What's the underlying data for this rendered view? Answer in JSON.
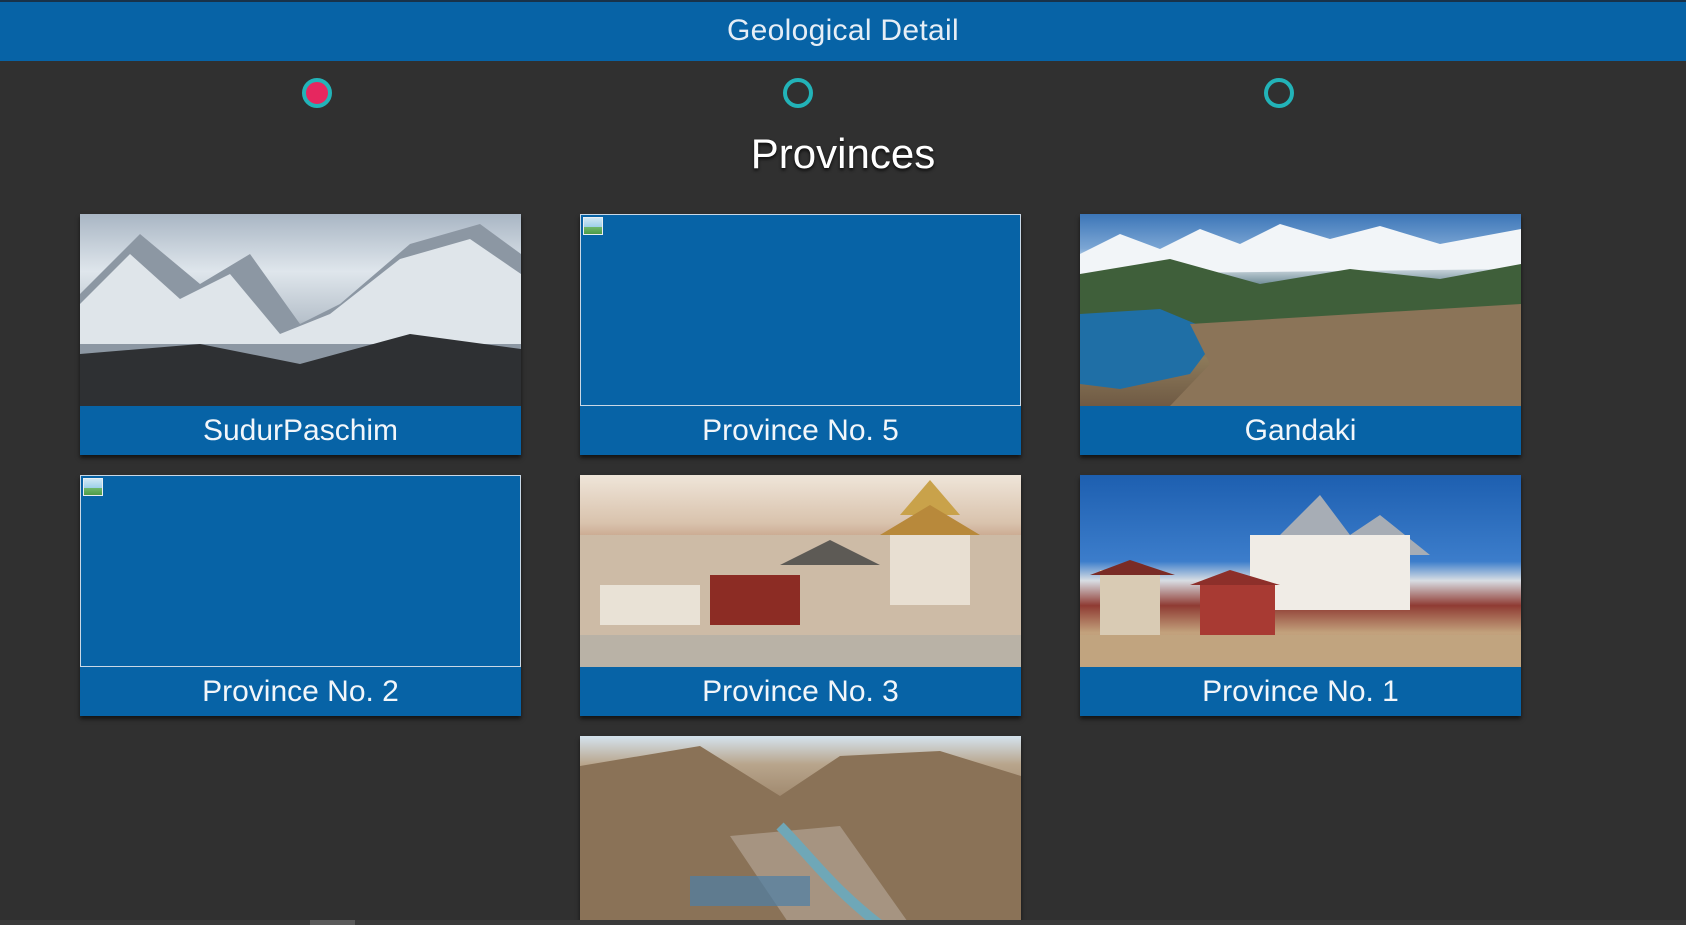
{
  "header": {
    "title": "Geological Detail"
  },
  "steps": [
    {
      "state": "active"
    },
    {
      "state": "inactive"
    },
    {
      "state": "inactive"
    }
  ],
  "main": {
    "title": "Provinces",
    "cards": [
      {
        "label": "SudurPaschim",
        "image": "snowy-mountains"
      },
      {
        "label": "Province No. 5",
        "image": "broken-image"
      },
      {
        "label": "Gandaki",
        "image": "lake-city-mountains"
      },
      {
        "label": "Province No. 2",
        "image": "broken-image"
      },
      {
        "label": "Province No. 3",
        "image": "temple-complex"
      },
      {
        "label": "Province No. 1",
        "image": "monastery-mountains"
      },
      {
        "label": "",
        "image": "mountain-valley"
      }
    ]
  },
  "colors": {
    "header": "#0763a6",
    "background": "#303030",
    "step_active": "#e6275f",
    "step_ring": "#22b3b8"
  }
}
